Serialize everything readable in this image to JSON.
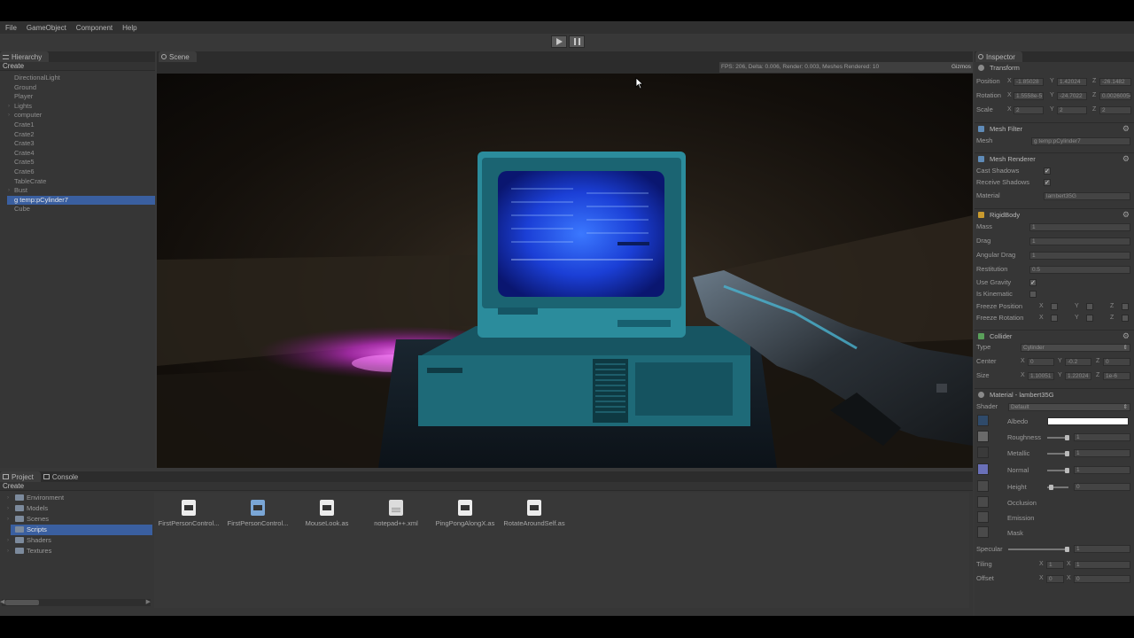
{
  "menubar": {
    "items": [
      "File",
      "GameObject",
      "Component",
      "Help"
    ]
  },
  "hierarchy": {
    "tab": "Hierarchy",
    "create": "Create",
    "items": [
      {
        "label": "DirectionalLight"
      },
      {
        "label": "Ground"
      },
      {
        "label": "Player"
      },
      {
        "label": "Lights",
        "expandable": true
      },
      {
        "label": "computer",
        "expandable": true
      },
      {
        "label": "Crate1"
      },
      {
        "label": "Crate2"
      },
      {
        "label": "Crate3"
      },
      {
        "label": "Crate4"
      },
      {
        "label": "Crate5"
      },
      {
        "label": "Crate6"
      },
      {
        "label": "TableCrate"
      },
      {
        "label": "Bust",
        "expandable": true
      },
      {
        "label": "g temp:pCylinder7",
        "selected": true
      },
      {
        "label": "Cube"
      }
    ]
  },
  "scene": {
    "tab": "Scene",
    "status": "FPS: 206, Delta: 0.006, Render: 0.003, Meshes Rendered: 10",
    "gizmos": "Gizmos"
  },
  "project": {
    "tab_project": "Project",
    "tab_console": "Console",
    "create": "Create",
    "folders": [
      {
        "label": "Environment"
      },
      {
        "label": "Models"
      },
      {
        "label": "Scenes"
      },
      {
        "label": "Scripts",
        "selected": true
      },
      {
        "label": "Shaders"
      },
      {
        "label": "Textures"
      }
    ],
    "files": [
      {
        "label": "FirstPersonControl...",
        "icon": "script-file-icon"
      },
      {
        "label": "FirstPersonControl...",
        "icon": "script-file-icon",
        "selected": true
      },
      {
        "label": "MouseLook.as",
        "icon": "script-file-icon"
      },
      {
        "label": "notepad++.xml",
        "icon": "text-file-icon"
      },
      {
        "label": "PingPongAlongX.as",
        "icon": "script-file-icon"
      },
      {
        "label": "RotateAroundSelf.as",
        "icon": "script-file-icon"
      }
    ]
  },
  "inspector": {
    "tab": "Inspector",
    "transform": {
      "title": "Transform",
      "position_label": "Position",
      "position": [
        "-1.85028",
        "1.42024",
        "-26.1482"
      ],
      "rotation_label": "Rotation",
      "rotation": [
        "1.5558e-5",
        "-24.7022",
        "0.00260054"
      ],
      "scale_label": "Scale",
      "scale": [
        "2",
        "2",
        "2"
      ]
    },
    "mesh_filter": {
      "title": "Mesh Filter",
      "mesh_label": "Mesh",
      "mesh": "g temp:pCylinder7"
    },
    "mesh_renderer": {
      "title": "Mesh Renderer",
      "cast_label": "Cast Shadows",
      "cast": true,
      "receive_label": "Receive Shadows",
      "receive": true,
      "material_label": "Material",
      "material": "lambert35G"
    },
    "rigidbody": {
      "title": "RigidBody",
      "mass_label": "Mass",
      "mass": "1",
      "drag_label": "Drag",
      "drag": "1",
      "angular_label": "Angular Drag",
      "angular": "1",
      "restitution_label": "Restitution",
      "restitution": "0.5",
      "gravity_label": "Use Gravity",
      "gravity": true,
      "kinematic_label": "Is Kinematic",
      "kinematic": false,
      "freeze_pos_label": "Freeze Position",
      "freeze_rot_label": "Freeze Rotation",
      "axes": [
        "X",
        "Y",
        "Z"
      ]
    },
    "collider": {
      "title": "Collider",
      "type_label": "Type",
      "type": "Cylinder",
      "center_label": "Center",
      "center": [
        "0",
        "-0.2",
        "0"
      ],
      "size_label": "Size",
      "size": [
        "1.10051",
        "1.22024",
        "1e-6"
      ]
    },
    "material": {
      "title": "Material - lambert35G",
      "shader_label": "Shader",
      "shader": "Default",
      "albedo_label": "Albedo",
      "albedo_color": "#ffffff",
      "roughness_label": "Roughness",
      "roughness": "1",
      "metallic_label": "Metallic",
      "metallic": "1",
      "normal_label": "Normal",
      "normal": "1",
      "height_label": "Height",
      "height": "0",
      "occlusion_label": "Occlusion",
      "emission_label": "Emission",
      "mask_label": "Mask",
      "specular_label": "Specular",
      "specular": "1",
      "tiling_label": "Tiling",
      "tiling": [
        "1",
        "1"
      ],
      "offset_label": "Offset",
      "offset": [
        "0",
        "0"
      ]
    }
  },
  "colors": {
    "selection": "#3a5fa0",
    "panel": "#363636",
    "screen_blue": "#1b3fd6",
    "magenta_light": "#e040e8"
  }
}
